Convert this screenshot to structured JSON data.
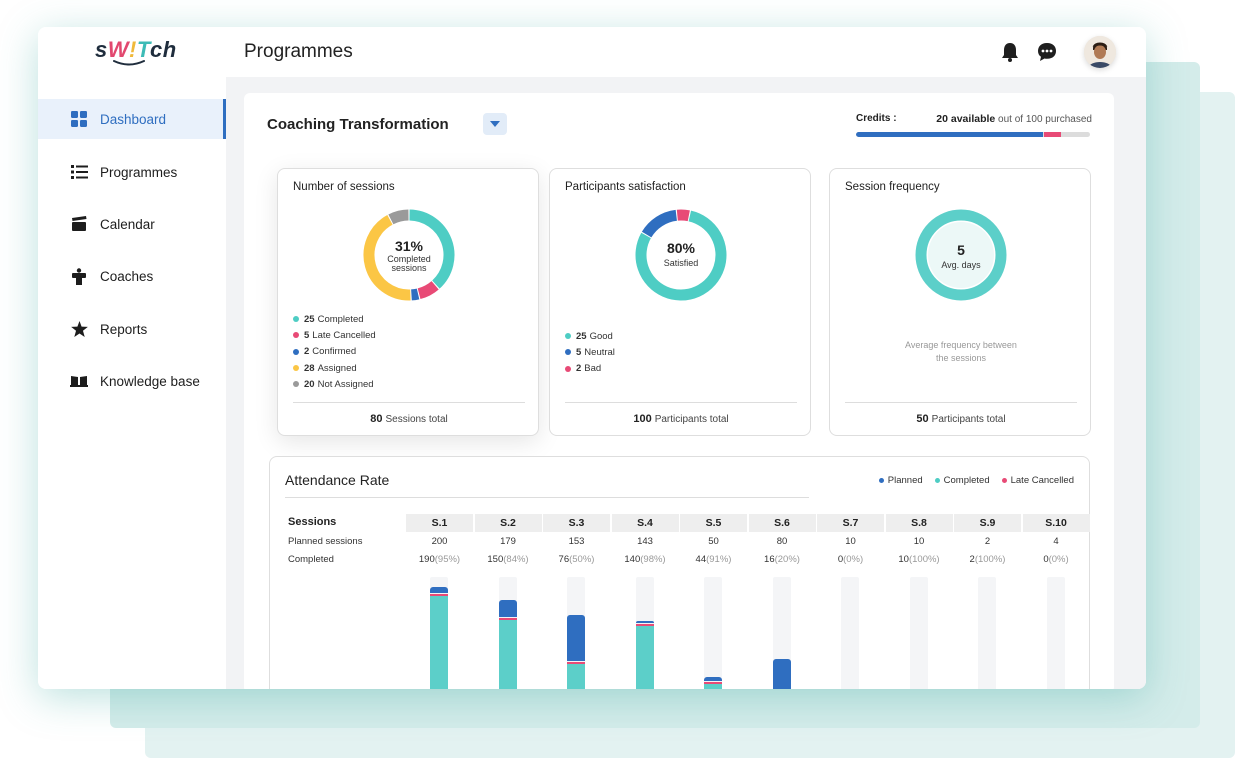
{
  "app": {
    "logo_text": "sW!Tch",
    "page_title": "Programmes"
  },
  "sidebar": {
    "items": [
      {
        "label": "Dashboard",
        "icon": "grid-icon",
        "active": true
      },
      {
        "label": "Programmes",
        "icon": "list-icon"
      },
      {
        "label": "Calendar",
        "icon": "clapboard-icon"
      },
      {
        "label": "Coaches",
        "icon": "easel-icon"
      },
      {
        "label": "Reports",
        "icon": "star-icon"
      },
      {
        "label": "Knowledge base",
        "icon": "book-icon"
      }
    ]
  },
  "header": {
    "icons": [
      "bell-icon",
      "chat-icon",
      "avatar"
    ]
  },
  "programme": {
    "name": "Coaching Transformation",
    "credits": {
      "label": "Credits :",
      "available": "20 available",
      "suffix": "out of 100 purchased",
      "used_fraction": 0.8,
      "pending_fraction": 0.07
    }
  },
  "cards": {
    "sessions": {
      "title": "Number of sessions",
      "center_value": "31%",
      "center_label_1": "Completed",
      "center_label_2": "sessions",
      "legend": [
        {
          "count": "25",
          "label": "Completed",
          "color": "#4ecdc4",
          "value": 25
        },
        {
          "count": "5",
          "label": "Late Cancelled",
          "color": "#e84a76",
          "value": 5
        },
        {
          "count": "2",
          "label": "Confirmed",
          "color": "#2f6ec0",
          "value": 2
        },
        {
          "count": "28",
          "label": "Assigned",
          "color": "#fbc645",
          "value": 28
        },
        {
          "count": "20",
          "label": "Not Assigned",
          "color": "#9a9a9a",
          "value": 5
        }
      ],
      "total_value": "80",
      "total_label": "Sessions total"
    },
    "satisfaction": {
      "title": "Participants satisfaction",
      "center_value": "80%",
      "center_label": "Satisfied",
      "legend": [
        {
          "count": "25",
          "label": "Good",
          "color": "#4ecdc4",
          "value": 80
        },
        {
          "count": "5",
          "label": "Neutral",
          "color": "#2f6ec0",
          "value": 15
        },
        {
          "count": "2",
          "label": "Bad",
          "color": "#e84a76",
          "value": 5
        }
      ],
      "total_value": "100",
      "total_label": "Participants total"
    },
    "frequency": {
      "title": "Session frequency",
      "center_value": "5",
      "center_label": "Avg. days",
      "note_1": "Average frequency between",
      "note_2": "the sessions",
      "total_value": "50",
      "total_label": "Participants total"
    }
  },
  "attendance": {
    "title": "Attendance Rate",
    "legend": [
      {
        "label": "Planned",
        "color": "#2f6ec0"
      },
      {
        "label": "Completed",
        "color": "#4ecdc4"
      },
      {
        "label": "Late Cancelled",
        "color": "#e84a76"
      }
    ],
    "row_labels": {
      "sessions": "Sessions",
      "planned": "Planned sessions",
      "completed": "Completed"
    },
    "columns": [
      {
        "name": "S.1",
        "planned": "200",
        "completed": "190",
        "pct": "(95%)"
      },
      {
        "name": "S.2",
        "planned": "179",
        "completed": "150",
        "pct": "(84%)"
      },
      {
        "name": "S.3",
        "planned": "153",
        "completed": "76",
        "pct": "(50%)"
      },
      {
        "name": "S.4",
        "planned": "143",
        "completed": "140",
        "pct": "(98%)"
      },
      {
        "name": "S.5",
        "planned": "50",
        "completed": "44",
        "pct": "(91%)"
      },
      {
        "name": "S.6",
        "planned": "80",
        "completed": "16",
        "pct": "(20%)"
      },
      {
        "name": "S.7",
        "planned": "10",
        "completed": "0",
        "pct": "(0%)"
      },
      {
        "name": "S.8",
        "planned": "10",
        "completed": "10",
        "pct": "(100%)"
      },
      {
        "name": "S.9",
        "planned": "2",
        "completed": "2",
        "pct": "(100%)"
      },
      {
        "name": "S.10",
        "planned": "4",
        "completed": "0",
        "pct": "(0%)"
      }
    ]
  },
  "chart_data": {
    "type": "bar",
    "categories": [
      "S.1",
      "S.2",
      "S.3",
      "S.4",
      "S.5",
      "S.6",
      "S.7",
      "S.8",
      "S.9",
      "S.10"
    ],
    "series": [
      {
        "name": "Planned",
        "values": [
          200,
          179,
          153,
          143,
          50,
          80,
          10,
          10,
          2,
          4
        ]
      },
      {
        "name": "Completed",
        "values": [
          190,
          150,
          76,
          140,
          44,
          16,
          0,
          10,
          2,
          0
        ]
      }
    ],
    "title": "Attendance Rate",
    "legend": [
      "Planned",
      "Completed",
      "Late Cancelled"
    ]
  }
}
